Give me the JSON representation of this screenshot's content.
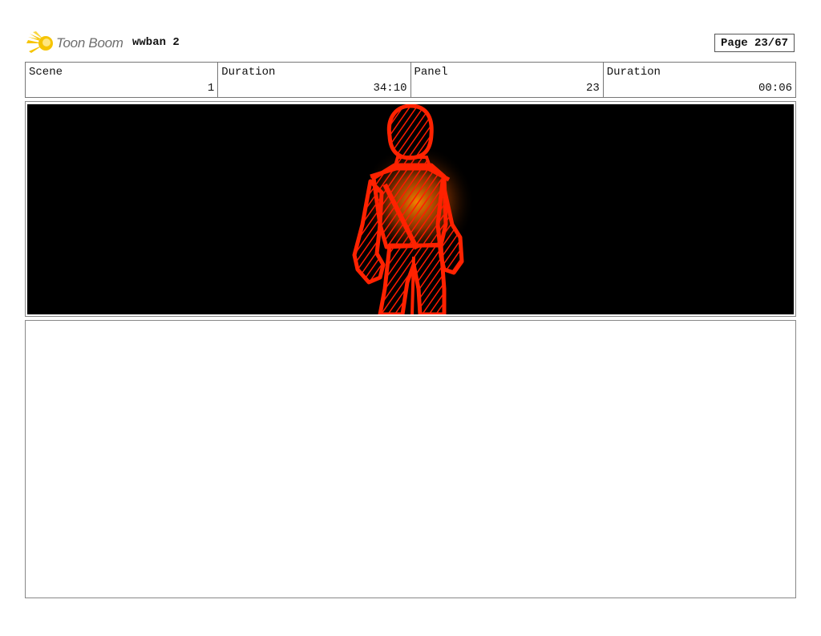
{
  "header": {
    "logo_text": "Toon Boom",
    "project_title": "wwban 2",
    "page_label": "Page 23/67"
  },
  "info": {
    "scene_label": "Scene",
    "scene_value": "1",
    "scene_duration_label": "Duration",
    "scene_duration_value": "34:10",
    "panel_label": "Panel",
    "panel_value": "23",
    "panel_duration_label": "Duration",
    "panel_duration_value": "00:06"
  },
  "panel": {
    "background": "#000000",
    "figure_color": "#ff1a00",
    "glow_color": "#ff7a00"
  },
  "notes": {}
}
